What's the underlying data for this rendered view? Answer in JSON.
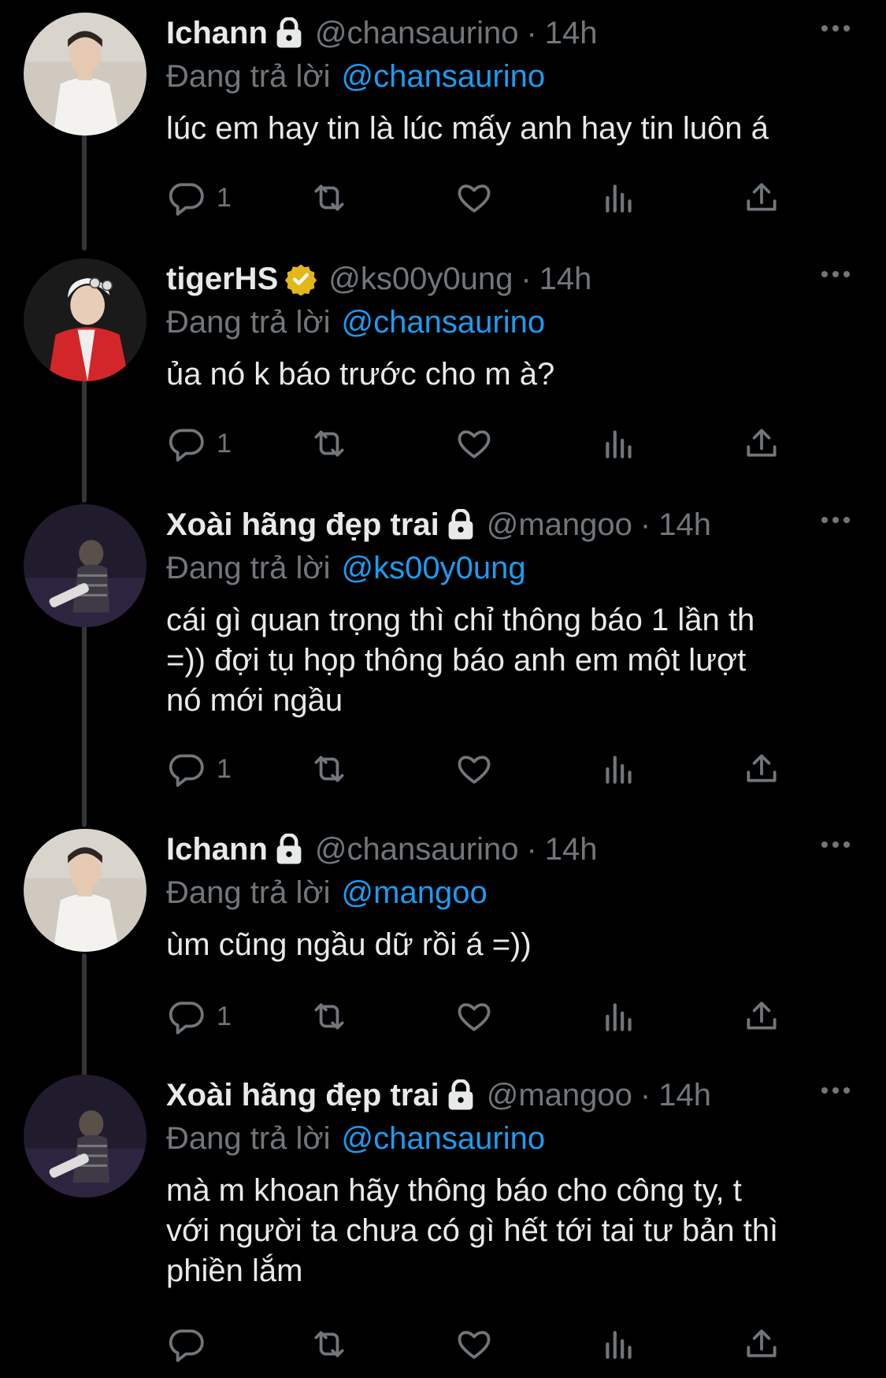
{
  "colors": {
    "background": "#000000",
    "text": "#e7e9ea",
    "muted": "#71767b",
    "link": "#1d9bf0",
    "verified_gold": "#e2b719",
    "thread_line": "#333639"
  },
  "reply_prefix": "Đang trả lời",
  "tweets": [
    {
      "name": "Ichann",
      "badge": "lock-icon",
      "handle": "@chansaurino",
      "dot": "·",
      "time": "14h",
      "reply_to": "@chansaurino",
      "text": "lúc em hay tin là lúc mấy anh hay tin luôn á",
      "reply_count": "1",
      "avatar": "person-white-shirt"
    },
    {
      "name": "tigerHS",
      "badge": "verified-gold-icon",
      "handle": "@ks00y0ung",
      "dot": "·",
      "time": "14h",
      "reply_to": "@chansaurino",
      "text": "ủa nó k báo trước cho m à?",
      "reply_count": "1",
      "avatar": "person-red-jacket"
    },
    {
      "name": "Xoài hãng đẹp trai",
      "badge": "lock-icon",
      "handle": "@mangoo",
      "dot": "·",
      "time": "14h",
      "reply_to": "@ks00y0ung",
      "text": "cái gì quan trọng thì chỉ thông báo 1 lần th\n=)) đợi tụ họp thông báo anh em một lượt\nnó mới ngầu",
      "reply_count": "1",
      "avatar": "person-guitar-purple"
    },
    {
      "name": "Ichann",
      "badge": "lock-icon",
      "handle": "@chansaurino",
      "dot": "·",
      "time": "14h",
      "reply_to": "@mangoo",
      "text": "ùm cũng ngầu dữ rồi á =))",
      "reply_count": "1",
      "avatar": "person-white-shirt"
    },
    {
      "name": "Xoài hãng đẹp trai",
      "badge": "lock-icon",
      "handle": "@mangoo",
      "dot": "·",
      "time": "14h",
      "reply_to": "@chansaurino",
      "text": "mà m khoan hãy thông báo cho công ty, t\nvới người ta chưa có gì hết tới tai tư bản thì\nphiền lắm",
      "reply_count": "",
      "avatar": "person-guitar-purple"
    }
  ]
}
